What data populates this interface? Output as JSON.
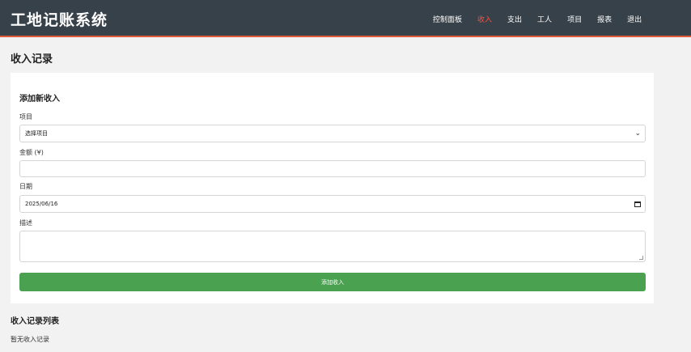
{
  "app": {
    "title": "工地记账系统"
  },
  "nav": {
    "items": [
      {
        "label": "控制面板",
        "active": false
      },
      {
        "label": "收入",
        "active": true
      },
      {
        "label": "支出",
        "active": false
      },
      {
        "label": "工人",
        "active": false
      },
      {
        "label": "项目",
        "active": false
      },
      {
        "label": "报表",
        "active": false
      },
      {
        "label": "退出",
        "active": false
      }
    ]
  },
  "page": {
    "title": "收入记录"
  },
  "form": {
    "title": "添加新收入",
    "project_label": "项目",
    "project_value": "选择项目",
    "amount_label": "金额 (¥)",
    "amount_value": "",
    "date_label": "日期",
    "date_value": "2025/06/16",
    "description_label": "描述",
    "description_value": "",
    "submit_label": "添加收入"
  },
  "list": {
    "title": "收入记录列表",
    "empty_text": "暂无收入记录"
  },
  "colors": {
    "navbar_bg": "#37414a",
    "accent": "#ff4d3a",
    "submit_bg": "#4aa150"
  },
  "icons": {
    "select": "chevron-down-icon",
    "date": "calendar-icon",
    "resize": "resize-grip-icon"
  }
}
